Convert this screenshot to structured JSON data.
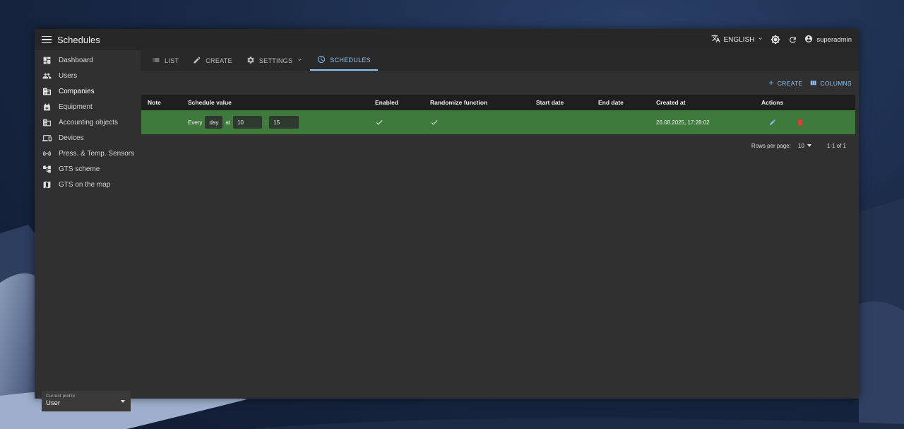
{
  "window": {
    "title": "Schedules"
  },
  "header": {
    "language": "ENGLISH",
    "username": "superadmin"
  },
  "sidebar": {
    "items": [
      {
        "label": "Dashboard",
        "icon": "dashboard-icon"
      },
      {
        "label": "Users",
        "icon": "users-icon"
      },
      {
        "label": "Companies",
        "icon": "companies-icon"
      },
      {
        "label": "Equipment",
        "icon": "equipment-icon"
      },
      {
        "label": "Accounting objects",
        "icon": "accounting-icon"
      },
      {
        "label": "Devices",
        "icon": "devices-icon"
      },
      {
        "label": "Press. & Temp. Sensors",
        "icon": "sensors-icon"
      },
      {
        "label": "GTS scheme",
        "icon": "scheme-icon"
      },
      {
        "label": "GTS on the map",
        "icon": "map-icon"
      }
    ],
    "profile": {
      "label": "Current profile",
      "value": "User"
    }
  },
  "tabs": [
    {
      "label": "LIST",
      "icon": "list-icon"
    },
    {
      "label": "CREATE",
      "icon": "pencil-icon"
    },
    {
      "label": "SETTINGS",
      "icon": "gear-icon"
    },
    {
      "label": "SCHEDULES",
      "icon": "clock-icon"
    }
  ],
  "toolbar": {
    "create_label": "CREATE",
    "columns_label": "COLUMNS"
  },
  "table": {
    "headers": [
      "Note",
      "Schedule value",
      "Enabled",
      "Randomize function",
      "Start date",
      "End date",
      "Created at",
      "Actions"
    ],
    "rows": [
      {
        "note": "",
        "schedule": {
          "every": "Every",
          "period": "day",
          "at": "at",
          "hour": "10",
          "sep": ":",
          "minute": "15"
        },
        "enabled": true,
        "randomize": true,
        "start_date": "",
        "end_date": "",
        "created_at": "26.08.2025, 17:28:02"
      }
    ]
  },
  "pagination": {
    "rows_per_page_label": "Rows per page:",
    "rows_per_page": "10",
    "range": "1-1 of 1"
  },
  "colors": {
    "accent": "#90c4f9",
    "row_highlight": "#3d7a3c",
    "delete": "#e53935",
    "edit": "#90c4f9"
  }
}
